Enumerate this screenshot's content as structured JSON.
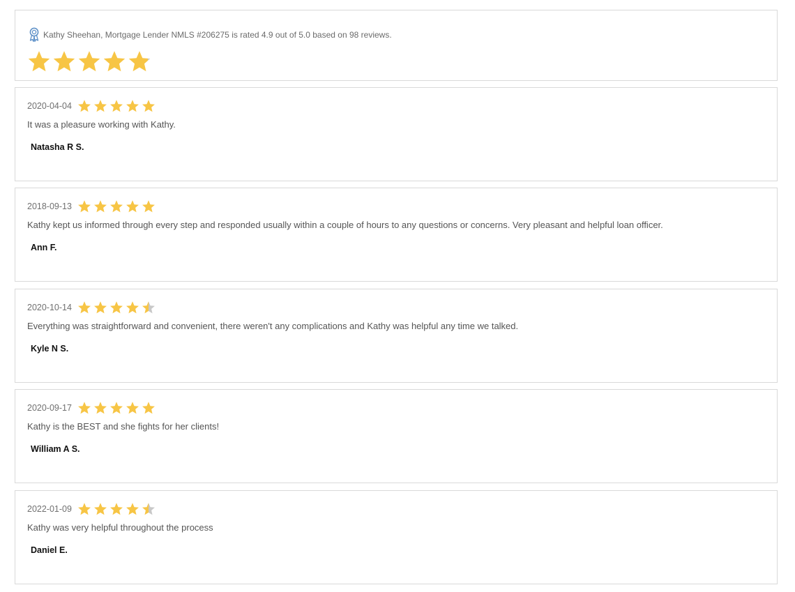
{
  "summary": {
    "text": "Kathy Sheehan, Mortgage Lender NMLS #206275 is rated 4.9 out of 5.0 based on 98 reviews.",
    "rating": 4.9,
    "max_rating": 5.0,
    "review_count": 98,
    "badge_icon": "award-ribbon-icon"
  },
  "colors": {
    "star_filled": "#f7c545",
    "star_empty": "#c8c8c8",
    "badge": "#5b8fc7",
    "border": "#d9d9d9"
  },
  "reviews": [
    {
      "date": "2020-04-04",
      "rating": 5,
      "text": "It was a pleasure working with Kathy.",
      "author": "Natasha R S."
    },
    {
      "date": "2018-09-13",
      "rating": 5,
      "text": "Kathy kept us informed through every step and responded usually within a couple of hours to any questions or concerns. Very pleasant and helpful loan officer.",
      "author": "Ann F."
    },
    {
      "date": "2020-10-14",
      "rating": 4.5,
      "text": "Everything was straightforward and convenient, there weren't any complications and Kathy was helpful any time we talked.",
      "author": "Kyle N S."
    },
    {
      "date": "2020-09-17",
      "rating": 5,
      "text": "Kathy is the BEST and she fights for her clients!",
      "author": "William A S."
    },
    {
      "date": "2022-01-09",
      "rating": 4.5,
      "text": "Kathy was very helpful throughout the process",
      "author": "Daniel E."
    }
  ]
}
